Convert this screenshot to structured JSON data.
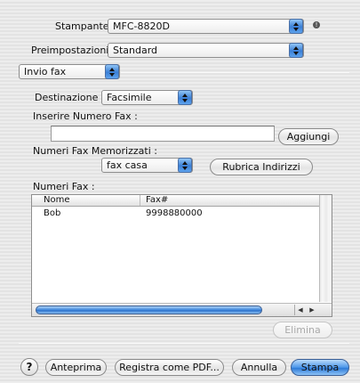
{
  "printer": {
    "label": "Stampante:",
    "value": "MFC-8820D"
  },
  "presets": {
    "label": "Preimpostazioni:",
    "value": "Standard"
  },
  "panel": {
    "value": "Invio fax"
  },
  "destination": {
    "label": "Destinazione :",
    "value": "Facsimile"
  },
  "fax_number": {
    "label": "Inserire Numero Fax :",
    "value": "",
    "add_label": "Aggiungi"
  },
  "stored": {
    "label": "Numeri Fax Memorizzati :",
    "value": "fax casa",
    "address_book_label": "Rubrica Indirizzi"
  },
  "fax_list": {
    "label": "Numeri Fax :",
    "columns": [
      "Nome",
      "Fax#"
    ],
    "rows": [
      {
        "name": "Bob",
        "fax": "9998880000"
      }
    ],
    "delete_label": "Elimina"
  },
  "footer": {
    "help_label": "?",
    "preview_label": "Anteprima",
    "save_pdf_label": "Registra come PDF...",
    "cancel_label": "Annulla",
    "print_label": "Stampa"
  },
  "icons": {
    "info": "info-icon",
    "help": "help-icon",
    "popup_arrows": "chevron-updown-icon",
    "scroll_arrows": "scroll-arrows-icon"
  },
  "colors": {
    "accent": "#3a7fd6",
    "background": "#e6e6e6"
  }
}
